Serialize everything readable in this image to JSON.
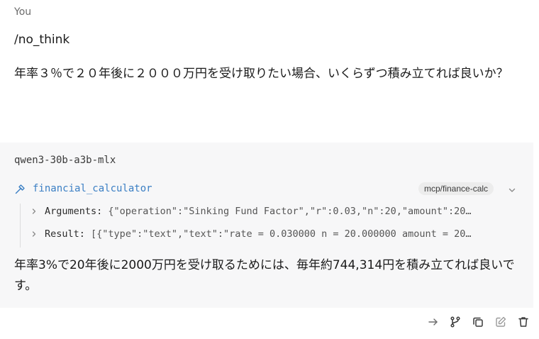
{
  "user": {
    "label": "You",
    "command": "/no_think",
    "question": "年率３％で２０年後に２０００万円を受け取りたい場合、いくらずつ積み立てれば良いか？"
  },
  "assistant": {
    "model": "qwen3-30b-a3b-mlx",
    "tool_call": {
      "icon": "hammer-icon",
      "name": "financial_calculator",
      "badge": "mcp/finance-calc",
      "arguments_label": "Arguments:",
      "arguments_value": "{\"operation\":\"Sinking Fund Factor\",\"r\":0.03,\"n\":20,\"amount\":20…",
      "result_label": "Result:",
      "result_value": "[{\"type\":\"text\",\"text\":\"rate = 0.030000 n = 20.000000 amount = 20…"
    },
    "answer": "年率3%で20年後に2000万円を受け取るためには、毎年約744,314円を積み立てれば良いです。"
  },
  "actions": [
    {
      "name": "forward-icon"
    },
    {
      "name": "branch-icon"
    },
    {
      "name": "copy-icon"
    },
    {
      "name": "edit-icon"
    },
    {
      "name": "trash-icon"
    }
  ],
  "colors": {
    "tool_link": "#3b7fc4",
    "assistant_bg": "#f7f7f8",
    "badge_bg": "#ececec"
  }
}
